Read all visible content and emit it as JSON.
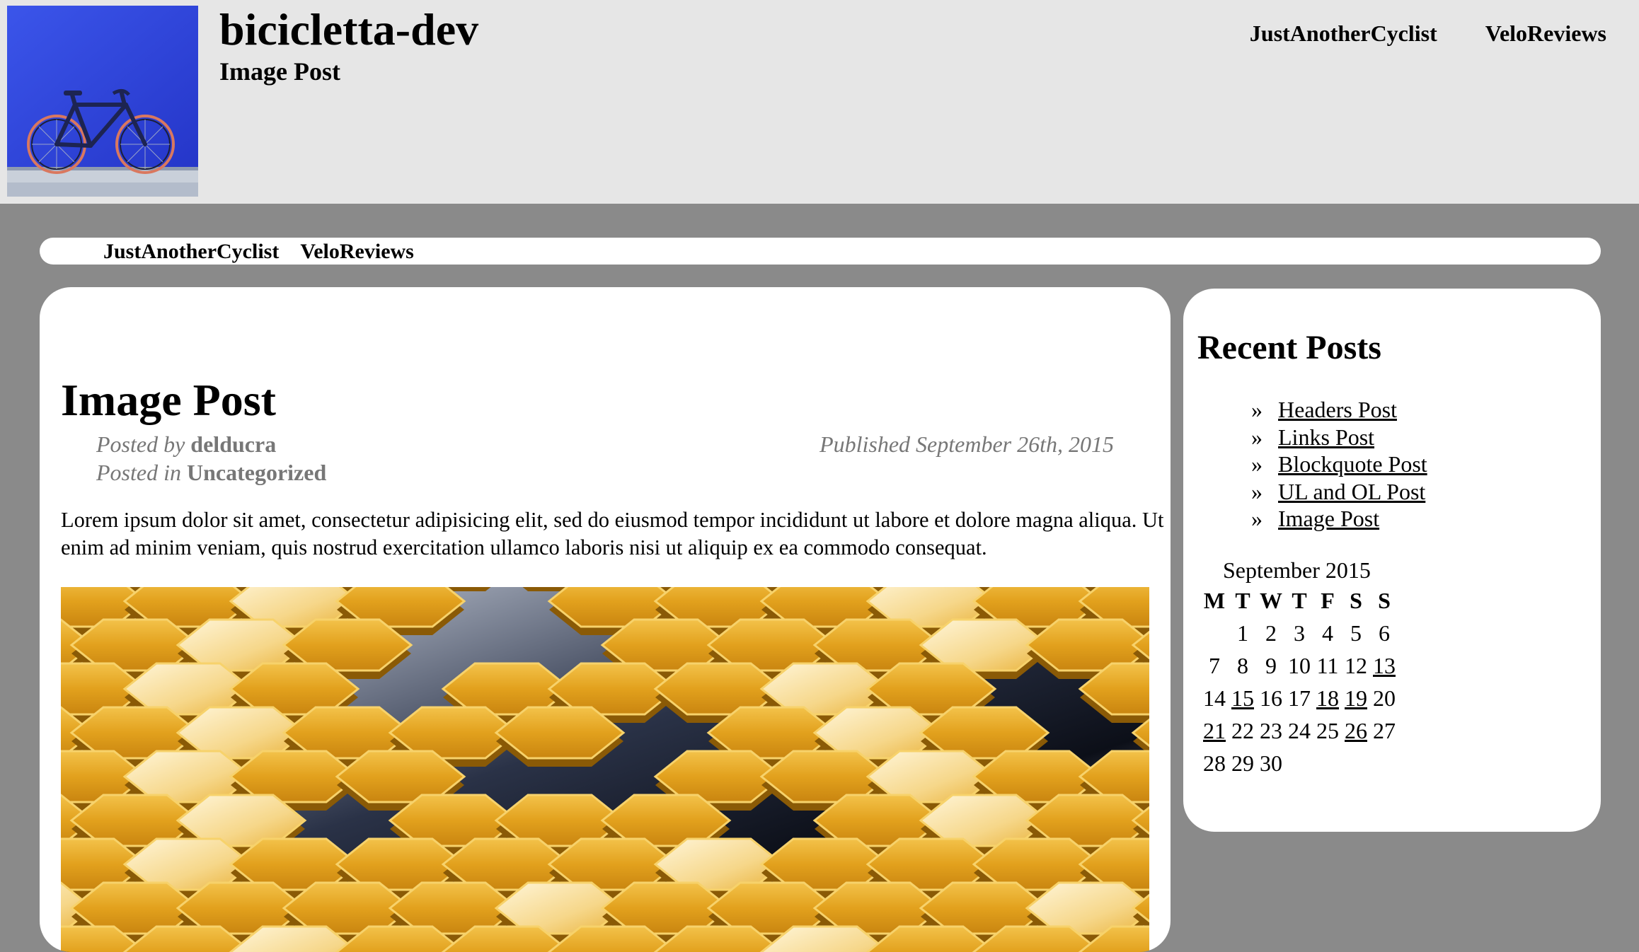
{
  "header": {
    "site_title": "bicicletta-dev",
    "site_subtitle": "Image Post",
    "logo_icon": "bicycle-photo",
    "nav": [
      "JustAnotherCyclist",
      "VeloReviews"
    ]
  },
  "nav_bar": {
    "items": [
      "JustAnotherCyclist",
      "VeloReviews"
    ]
  },
  "post": {
    "title": "Image Post",
    "posted_by_label": "Posted by",
    "author": "delducra",
    "posted_in_label": "Posted in",
    "category": "Uncategorized",
    "published": "Published September 26th, 2015",
    "body": "Lorem ipsum dolor sit amet, consectetur adipisicing elit, sed do eiusmod tempor incididunt ut labore et dolore magna aliqua. Ut enim ad minim veniam, quis nostrud exercitation ullamco laboris nisi ut aliquip ex ea commodo consequat.",
    "image_icon": "golden-hexagon-tiles"
  },
  "sidebar": {
    "recent_title": "Recent Posts",
    "bullet": "»",
    "recent_posts": [
      "Headers Post",
      "Links Post",
      "Blockquote Post",
      "UL and OL Post",
      "Image Post"
    ],
    "calendar": {
      "caption": "September 2015",
      "weekdays": [
        "M",
        "T",
        "W",
        "T",
        "F",
        "S",
        "S"
      ],
      "weeks": [
        [
          "",
          "1",
          "2",
          "3",
          "4",
          "5",
          "6"
        ],
        [
          "7",
          "8",
          "9",
          "10",
          "11",
          "12",
          "13"
        ],
        [
          "14",
          "15",
          "16",
          "17",
          "18",
          "19",
          "20"
        ],
        [
          "21",
          "22",
          "23",
          "24",
          "25",
          "26",
          "27"
        ],
        [
          "28",
          "29",
          "30",
          "",
          "",
          "",
          ""
        ]
      ],
      "linked_days": [
        "13",
        "15",
        "18",
        "19",
        "21",
        "26"
      ]
    }
  },
  "colors": {
    "page_background": "#8a8a8a",
    "header_background": "#e6e6e6",
    "card_background": "#ffffff",
    "meta_text": "#777777",
    "logo_wall_blue": "#3146e0",
    "hexagon_gold": "#e3a21e"
  }
}
